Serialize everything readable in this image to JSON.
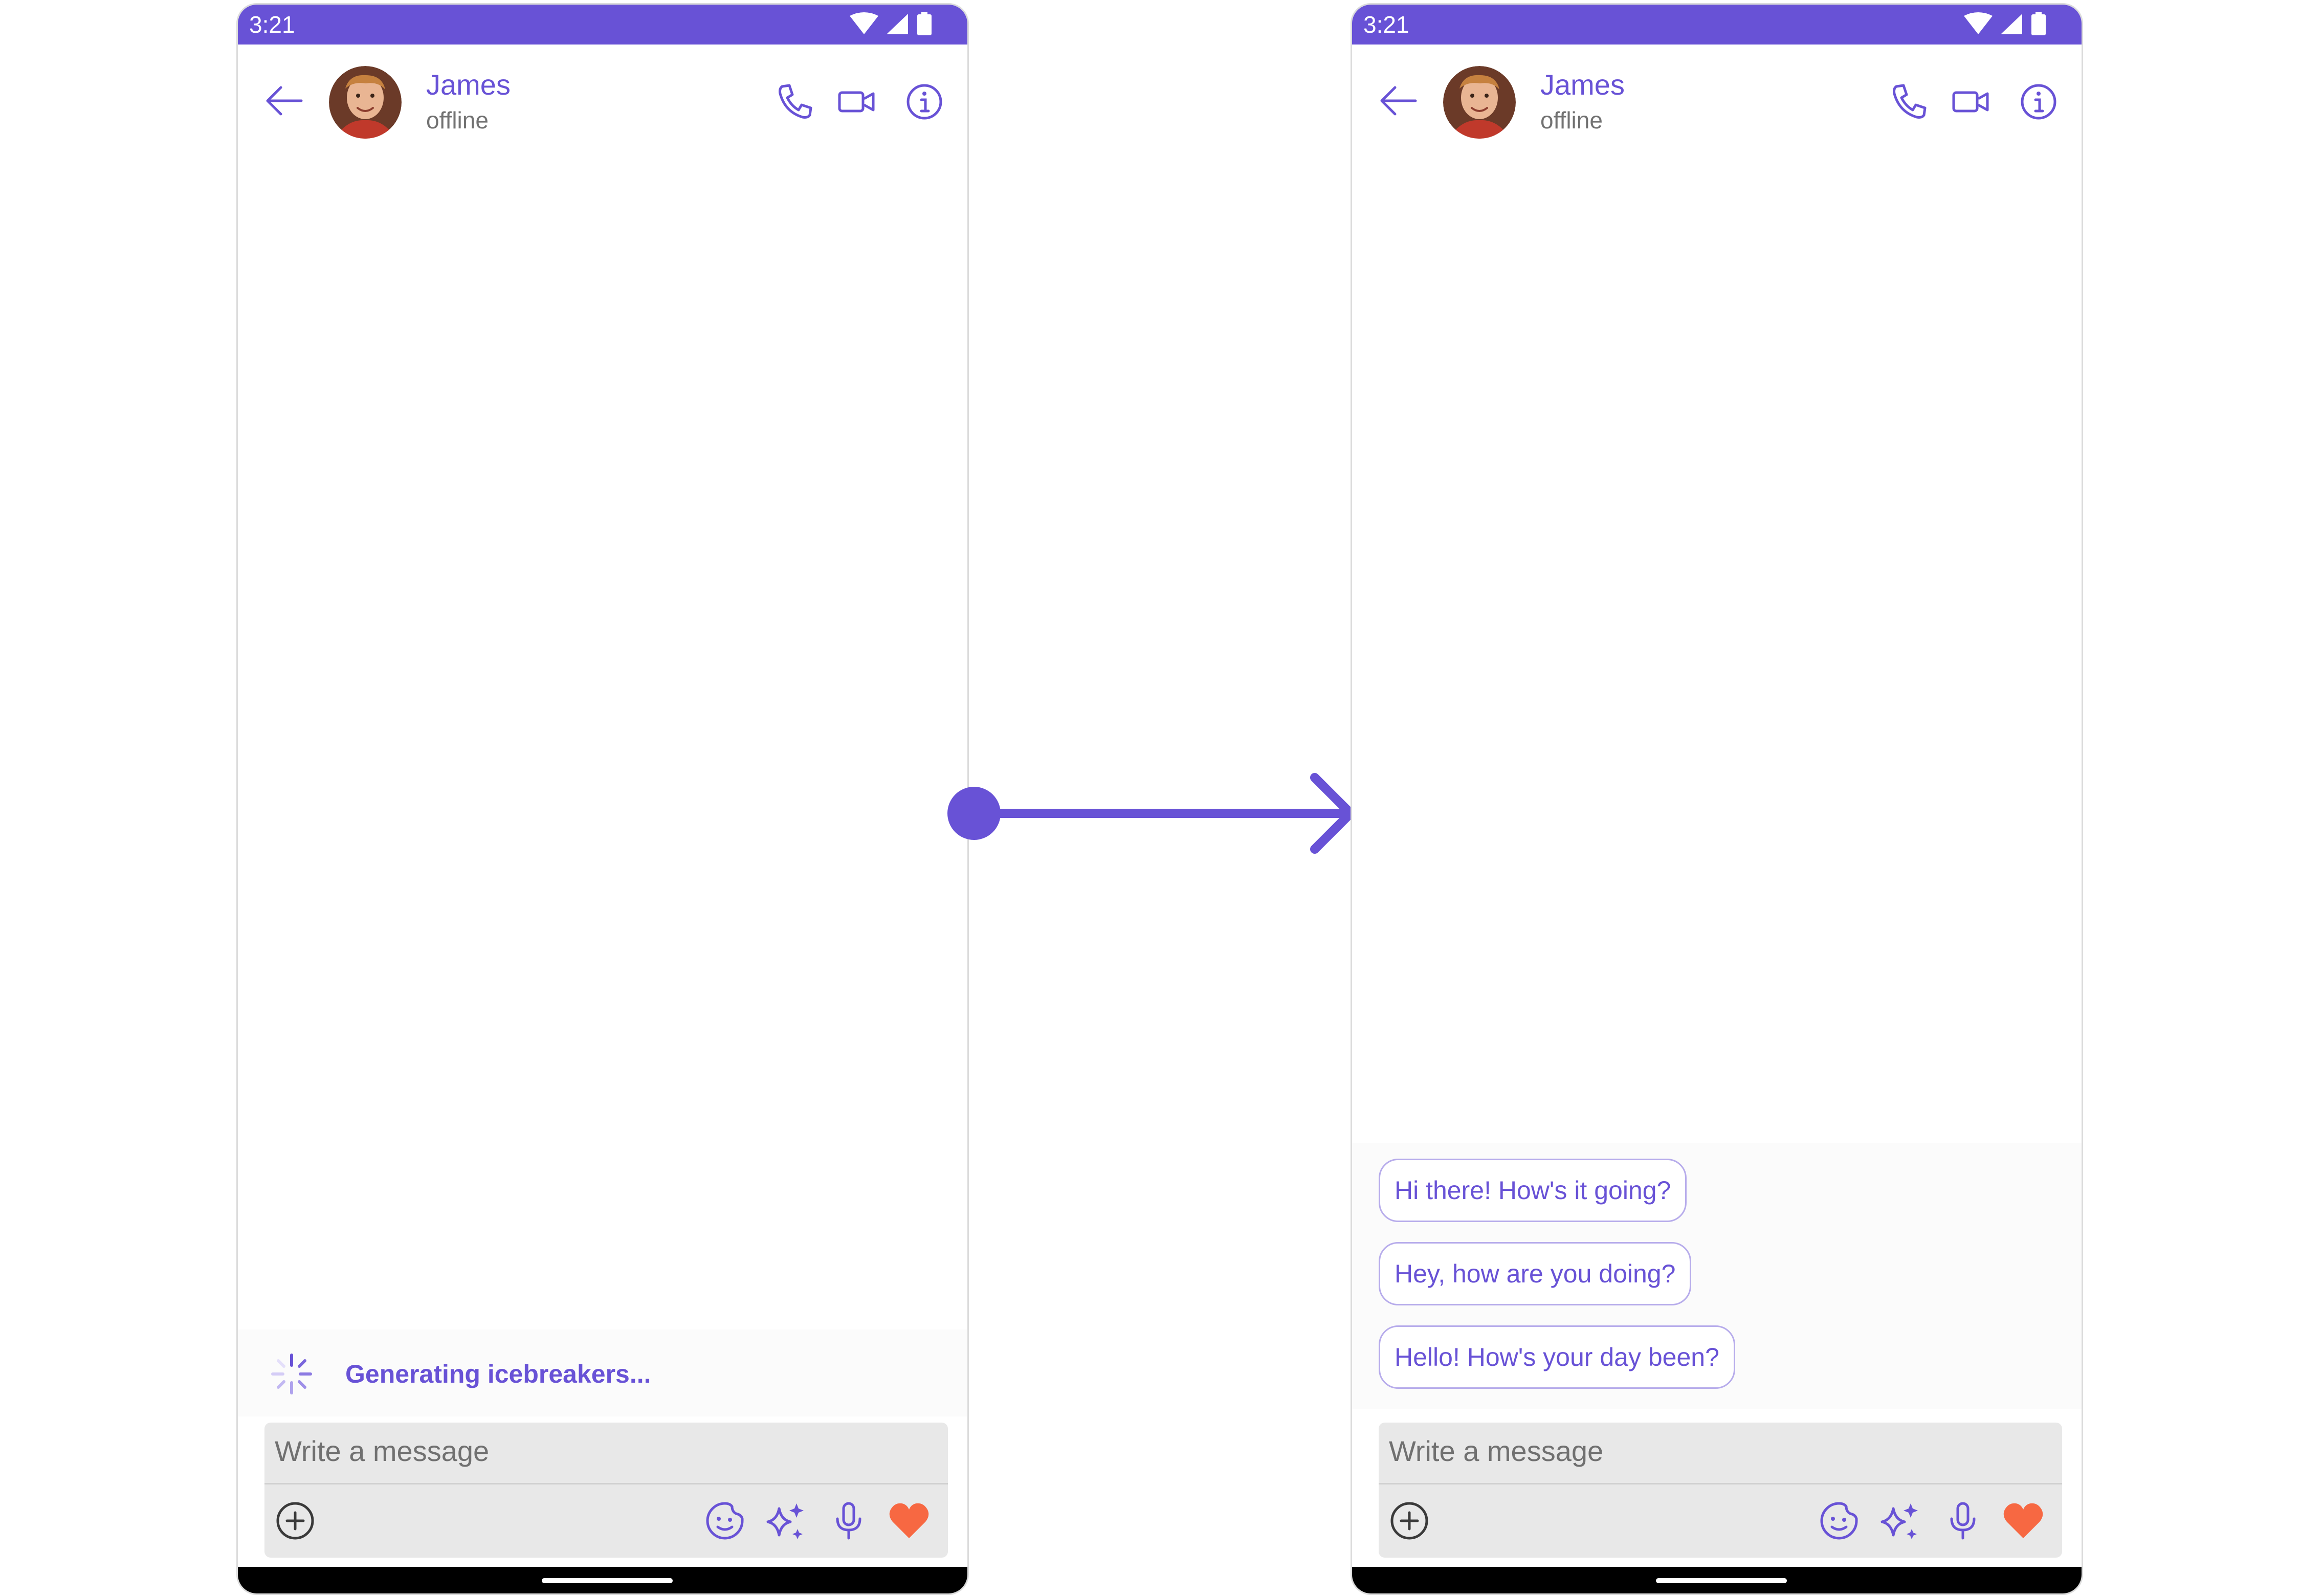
{
  "colors": {
    "accent": "#6852d6",
    "status_bar": "#6852d6",
    "heart": "#f76842",
    "chip_border": "#b7aceb",
    "composer_bg": "#e8e8e8",
    "muted_text": "#727272"
  },
  "screens": [
    {
      "status_bar": {
        "time": "3:21",
        "icons": [
          "wifi-icon",
          "signal-icon",
          "battery-icon"
        ]
      },
      "header": {
        "name": "James",
        "status": "offline",
        "icons": [
          "back-arrow-icon",
          "avatar",
          "voice-call-icon",
          "video-call-icon",
          "info-icon"
        ]
      },
      "ai_panel": {
        "text": "Generating icebreakers...",
        "icon": "loading-spinner-icon"
      },
      "composer": {
        "placeholder": "Write a message",
        "icons": [
          "attach-plus-icon",
          "sticker-icon",
          "ai-sparkle-icon",
          "microphone-icon",
          "heart-icon"
        ]
      }
    },
    {
      "status_bar": {
        "time": "3:21",
        "icons": [
          "wifi-icon",
          "signal-icon",
          "battery-icon"
        ]
      },
      "header": {
        "name": "James",
        "status": "offline",
        "icons": [
          "back-arrow-icon",
          "avatar",
          "voice-call-icon",
          "video-call-icon",
          "info-icon"
        ]
      },
      "icebreakers": [
        "Hi there! How's it going?",
        "Hey, how are you doing?",
        "Hello! How's your day been?"
      ],
      "composer": {
        "placeholder": "Write a message",
        "icons": [
          "attach-plus-icon",
          "sticker-icon",
          "ai-sparkle-icon",
          "microphone-icon",
          "heart-icon"
        ]
      }
    }
  ],
  "transition": {
    "icon": "transition-arrow-icon"
  }
}
